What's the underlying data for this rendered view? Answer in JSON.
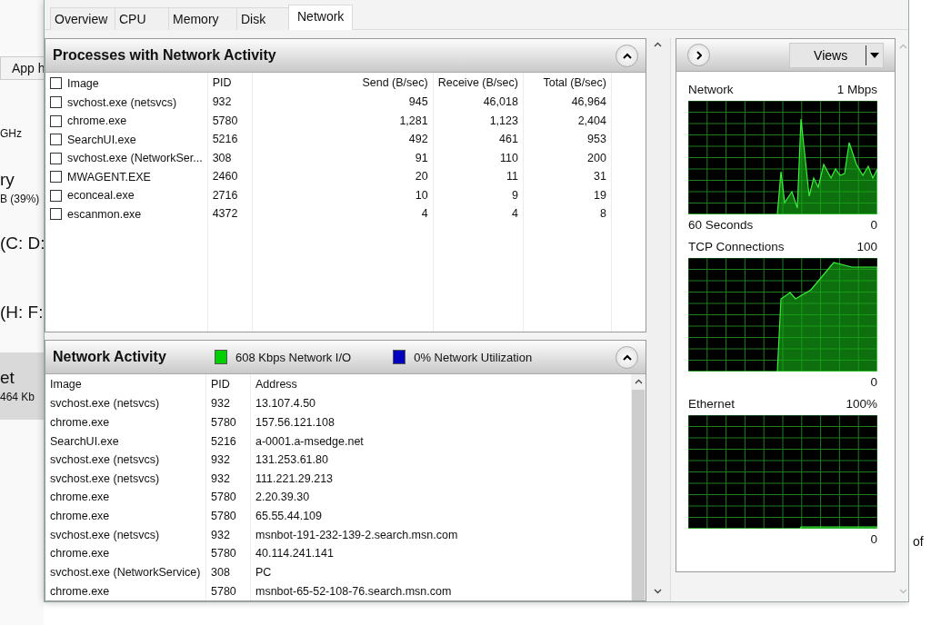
{
  "background_page": {
    "tab": "App h",
    "entries": [
      {
        "detail": "GHz",
        "selected": false
      },
      {
        "title": "ry",
        "detail": "B (39%)",
        "selected": false
      },
      {
        "title": "(C: D:",
        "selected": false
      },
      {
        "title": "(H: F:",
        "selected": false
      },
      {
        "title": "et",
        "detail": "464 Kb",
        "selected": true
      }
    ],
    "right_fragment": "of"
  },
  "tabs": [
    {
      "label": "Overview",
      "selected": false
    },
    {
      "label": "CPU",
      "selected": false
    },
    {
      "label": "Memory",
      "selected": false
    },
    {
      "label": "Disk",
      "selected": false
    },
    {
      "label": "Network",
      "selected": true
    }
  ],
  "processes_panel": {
    "title": "Processes with Network Activity",
    "select_all_checked": false,
    "columns": [
      "Image",
      "PID",
      "Send (B/sec)",
      "Receive (B/sec)",
      "Total (B/sec)"
    ],
    "rows": [
      {
        "image": "svchost.exe (netsvcs)",
        "pid": "932",
        "send": "945",
        "receive": "46,018",
        "total": "46,964",
        "checked": false
      },
      {
        "image": "chrome.exe",
        "pid": "5780",
        "send": "1,281",
        "receive": "1,123",
        "total": "2,404",
        "checked": false
      },
      {
        "image": "SearchUI.exe",
        "pid": "5216",
        "send": "492",
        "receive": "461",
        "total": "953",
        "checked": false
      },
      {
        "image": "svchost.exe (NetworkSer...",
        "pid": "308",
        "send": "91",
        "receive": "110",
        "total": "200",
        "checked": false
      },
      {
        "image": "MWAGENT.EXE",
        "pid": "2460",
        "send": "20",
        "receive": "11",
        "total": "31",
        "checked": false
      },
      {
        "image": "econceal.exe",
        "pid": "2716",
        "send": "10",
        "receive": "9",
        "total": "19",
        "checked": false
      },
      {
        "image": "escanmon.exe",
        "pid": "4372",
        "send": "4",
        "receive": "4",
        "total": "8",
        "checked": false
      }
    ]
  },
  "activity_panel": {
    "title": "Network Activity",
    "indicators": [
      {
        "text": "608 Kbps Network I/O",
        "color": "#00d000"
      },
      {
        "text": "0% Network Utilization",
        "color": "#0000c0"
      }
    ],
    "columns": [
      "Image",
      "PID",
      "Address"
    ],
    "rows": [
      {
        "image": "svchost.exe (netsvcs)",
        "pid": "932",
        "address": "13.107.4.50"
      },
      {
        "image": "chrome.exe",
        "pid": "5780",
        "address": "157.56.121.108"
      },
      {
        "image": "SearchUI.exe",
        "pid": "5216",
        "address": "a-0001.a-msedge.net"
      },
      {
        "image": "svchost.exe (netsvcs)",
        "pid": "932",
        "address": "131.253.61.80"
      },
      {
        "image": "svchost.exe (netsvcs)",
        "pid": "932",
        "address": "111.221.29.213"
      },
      {
        "image": "chrome.exe",
        "pid": "5780",
        "address": "2.20.39.30"
      },
      {
        "image": "chrome.exe",
        "pid": "5780",
        "address": "65.55.44.109"
      },
      {
        "image": "svchost.exe (netsvcs)",
        "pid": "932",
        "address": "msnbot-191-232-139-2.search.msn.com"
      },
      {
        "image": "chrome.exe",
        "pid": "5780",
        "address": "40.114.241.141"
      },
      {
        "image": "svchost.exe (NetworkService)",
        "pid": "308",
        "address": "PC"
      },
      {
        "image": "chrome.exe",
        "pid": "5780",
        "address": "msnbot-65-52-108-76.search.msn.com"
      }
    ]
  },
  "graphs_panel": {
    "views_button": "Views",
    "graphs": [
      {
        "kind": "traffic",
        "title": "Network",
        "max": "1 Mbps",
        "footer": "60 Seconds",
        "min": "0"
      },
      {
        "kind": "connections",
        "title": "TCP Connections",
        "max": "100",
        "min": "0"
      },
      {
        "kind": "utilization",
        "title": "Ethernet",
        "max": "100%",
        "min": "0"
      }
    ]
  }
}
